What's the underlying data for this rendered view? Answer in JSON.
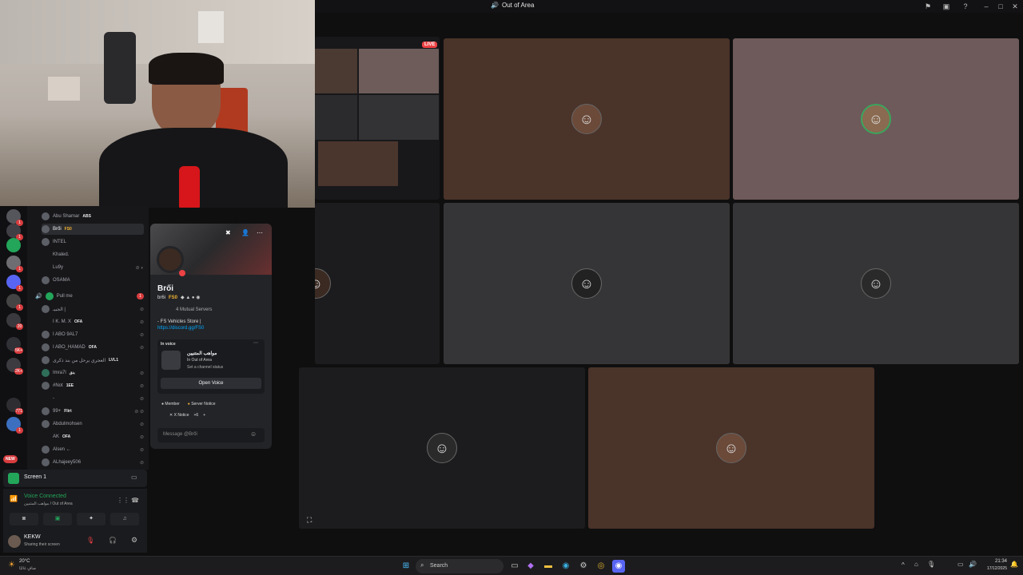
{
  "window": {
    "title": "Out of Area"
  },
  "stream": {
    "live_badge": "LIVE"
  },
  "servers": [
    {
      "badge": "1"
    },
    {
      "badge": "1"
    },
    {
      "badge": ""
    },
    {
      "badge": "1"
    },
    {
      "badge": "1"
    },
    {
      "badge": "1"
    },
    {
      "badge": "20"
    },
    {
      "badge": "5K+"
    },
    {
      "badge": "2K+"
    },
    {
      "badge": "771"
    },
    {
      "badge": "1"
    }
  ],
  "new_badge": "NEW",
  "members": [
    {
      "name": "Abu Shamar",
      "tag": "ABS"
    },
    {
      "name": "Brői",
      "tag": "FS0"
    },
    {
      "name": "INTEL",
      "tag": ""
    },
    {
      "name": "Khaled.",
      "tag": ""
    },
    {
      "name": "Lu9y",
      "tag": ""
    },
    {
      "name": "OSAMA",
      "tag": ""
    },
    {
      "name": "Pull me",
      "tag": ""
    },
    {
      "name": "الجبيـ |",
      "tag": ""
    },
    {
      "name": "I K. M. X",
      "tag": "OFA"
    },
    {
      "name": "I ABO 9AL7",
      "tag": ""
    },
    {
      "name": "I ABO_HAMAD",
      "tag": "OFA"
    },
    {
      "name": "العجري يرحل من بند ذكرى",
      "tag": "LVL1"
    },
    {
      "name": "Imra7l",
      "tag": "بنق"
    },
    {
      "name": "#Not",
      "tag": "1EE"
    },
    {
      "name": "-",
      "tag": ""
    },
    {
      "name": "99+",
      "tag": "Flirt"
    },
    {
      "name": "Abdulmohsen",
      "tag": ""
    },
    {
      "name": "AK",
      "tag": "OFA"
    },
    {
      "name": "Alsen ←",
      "tag": ""
    },
    {
      "name": "ALhajeey506",
      "tag": ""
    }
  ],
  "screen_panel": {
    "label": "Screen 1"
  },
  "voice_panel": {
    "status": "Voice Connected",
    "channel": "مواهب المتنيين / Out of Area"
  },
  "user_panel": {
    "name": "KEKW",
    "status": "Sharing their screen"
  },
  "profile": {
    "display_name": "Brői",
    "username": "br6i",
    "tag": "FS0",
    "mutual_servers": "4 Mutual Servers",
    "bio_line": "- FS Vehicles Store |",
    "bio_link": "https://discord.gg/FS0",
    "in_voice_label": "In voice",
    "voice_server": "مواهب المتنيين",
    "voice_channel": "In Out of Area",
    "set_status": "Set a channel status",
    "open_voice_button": "Open Voice",
    "roles": [
      "Member",
      "Server Notice",
      "X Notice"
    ],
    "roles_more": "+6",
    "message_placeholder": "Message @Brői"
  },
  "taskbar": {
    "weather_temp": "20°C",
    "weather_desc": "صافٍ غالبًا",
    "search_label": "Search",
    "time": "21:34",
    "date": "17/12/2025"
  }
}
